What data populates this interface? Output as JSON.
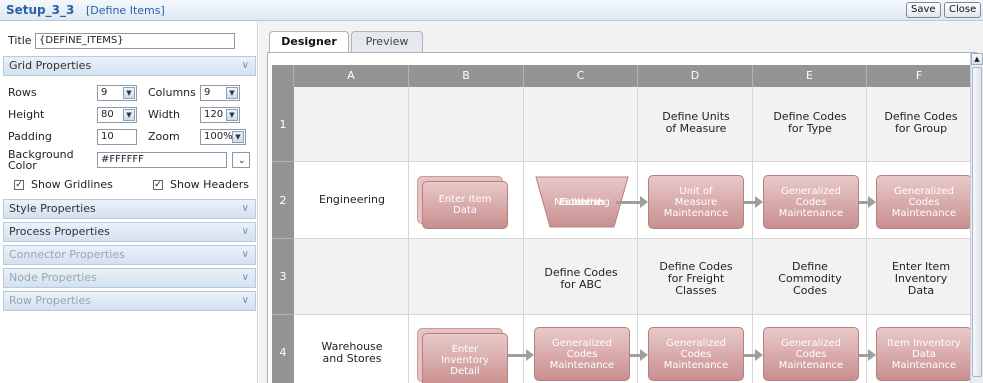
{
  "window": {
    "title": "Setup_3_3",
    "subtitle": "[Define Items]",
    "save_label": "Save",
    "close_label": "Close"
  },
  "left": {
    "title_label": "Title",
    "title_value": "{DEFINE_ITEMS}",
    "grid_section": "Grid Properties",
    "rows_label": "Rows",
    "rows_value": "9",
    "columns_label": "Columns",
    "columns_value": "9",
    "height_label": "Height",
    "height_value": "80",
    "width_label": "Width",
    "width_value": "120",
    "padding_label": "Padding",
    "padding_value": "10",
    "zoom_label": "Zoom",
    "zoom_value": "100%",
    "bg_label_1": "Background",
    "bg_label_2": "Color",
    "bg_value": "#FFFFFF",
    "show_gridlines": "Show Gridlines",
    "show_headers": "Show Headers",
    "sections": [
      "Style Properties",
      "Process Properties",
      "Connector Properties",
      "Node Properties",
      "Row Properties"
    ]
  },
  "tabs": {
    "designer": "Designer",
    "preview": "Preview"
  },
  "grid": {
    "columns": [
      "A",
      "B",
      "C",
      "D",
      "E",
      "F"
    ],
    "rows": [
      "1",
      "2",
      "3",
      "4"
    ],
    "row1": {
      "d": [
        "Define Units",
        "of Measure"
      ],
      "e": [
        "Define Codes",
        "for Type"
      ],
      "f": [
        "Define Codes",
        "for Group"
      ]
    },
    "row2": {
      "a": "Engineering",
      "b": [
        "Enter Item",
        "Data"
      ],
      "c": [
        "Establish",
        "Numbering",
        "Scheme"
      ],
      "d": [
        "Unit of",
        "Measure",
        "Maintenance"
      ],
      "e": [
        "Generalized",
        "Codes",
        "Maintenance"
      ],
      "f": [
        "Generalized",
        "Codes",
        "Maintenance"
      ]
    },
    "row3": {
      "c": [
        "Define Codes",
        "for ABC"
      ],
      "d": [
        "Define Codes",
        "for Freight",
        "Classes"
      ],
      "e": [
        "Define",
        "Commodity",
        "Codes"
      ],
      "f": [
        "Enter Item",
        "Inventory",
        "Data"
      ]
    },
    "row4": {
      "a": [
        "Warehouse",
        "and Stores"
      ],
      "b": [
        "Enter",
        "Inventory",
        "Detail"
      ],
      "c": [
        "Generalized",
        "Codes",
        "Maintenance"
      ],
      "d": [
        "Generalized",
        "Codes",
        "Maintenance"
      ],
      "e": [
        "Generalized",
        "Codes",
        "Maintenance"
      ],
      "f": [
        "Item Inventory",
        "Data",
        "Maintenance"
      ]
    }
  },
  "colors": {
    "accent": "#2a62a8",
    "header_gray": "#949494",
    "node_fill": "#c98f8f"
  }
}
